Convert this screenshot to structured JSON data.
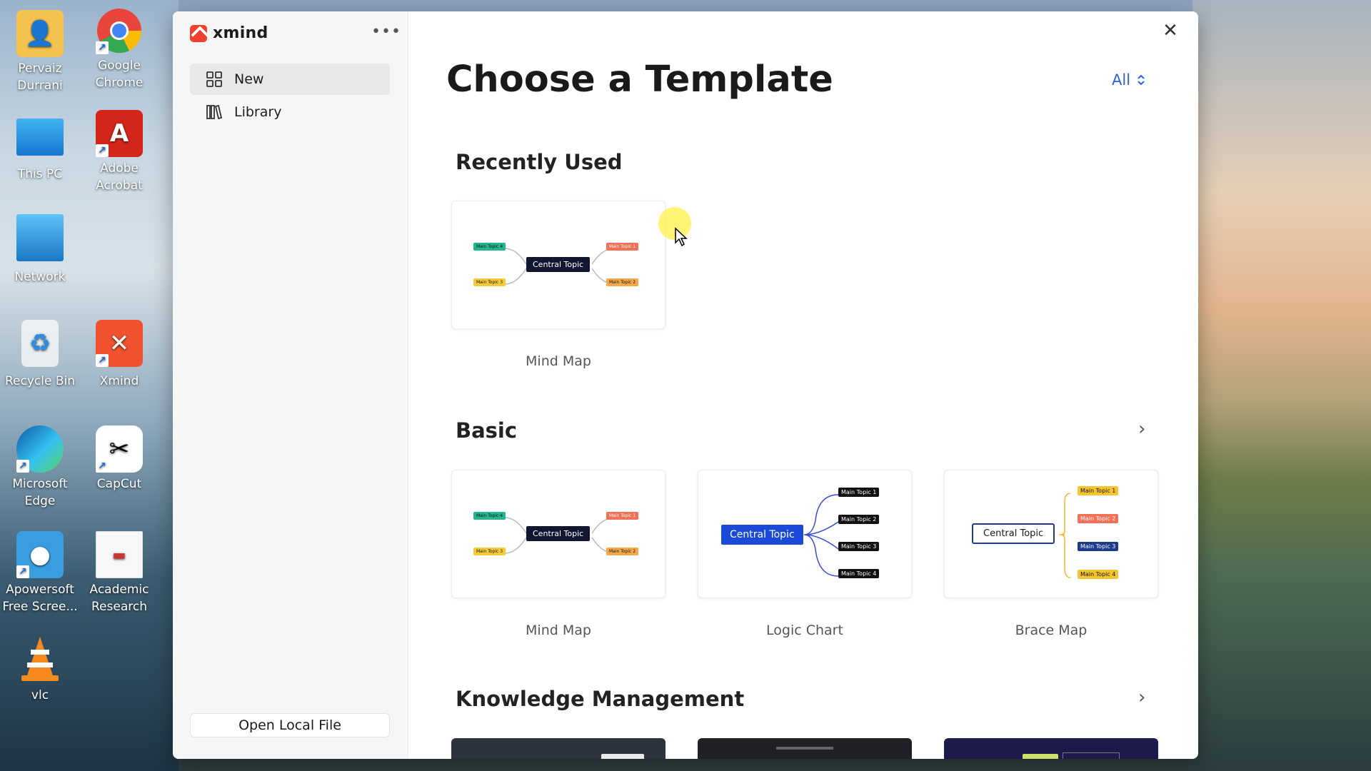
{
  "desktop": {
    "icons": [
      {
        "label_1": "Pervaiz",
        "label_2": "Durrani",
        "icon": "user-folder-icon"
      },
      {
        "label_1": "Google",
        "label_2": "Chrome",
        "icon": "chrome-icon"
      },
      {
        "label_1": "This PC",
        "label_2": "",
        "icon": "monitor-icon"
      },
      {
        "label_1": "Adobe",
        "label_2": "Acrobat",
        "icon": "acrobat-icon"
      },
      {
        "label_1": "Network",
        "label_2": "",
        "icon": "network-icon"
      },
      {
        "label_1": "Recycle Bin",
        "label_2": "",
        "icon": "recycle-bin-icon"
      },
      {
        "label_1": "Xmind",
        "label_2": "",
        "icon": "xmind-icon"
      },
      {
        "label_1": "Microsoft",
        "label_2": "Edge",
        "icon": "edge-icon"
      },
      {
        "label_1": "CapCut",
        "label_2": "",
        "icon": "capcut-icon"
      },
      {
        "label_1": "Apowersoft",
        "label_2": "Free Scree...",
        "icon": "apowersoft-icon"
      },
      {
        "label_1": "Academic",
        "label_2": "Research",
        "icon": "document-icon"
      },
      {
        "label_1": "vlc",
        "label_2": "",
        "icon": "vlc-icon"
      }
    ]
  },
  "app": {
    "name": "xmind",
    "more_label": "•••",
    "close_label": "✕"
  },
  "sidebar": {
    "items": [
      {
        "label": "New",
        "icon": "grid-icon",
        "active": true
      },
      {
        "label": "Library",
        "icon": "library-icon",
        "active": false
      }
    ],
    "open_local": "Open Local File"
  },
  "main": {
    "title": "Choose a Template",
    "filter": "All",
    "sections": [
      {
        "title": "Recently Used"
      },
      {
        "title": "Basic"
      },
      {
        "title": "Knowledge Management"
      }
    ],
    "recent_cards": [
      {
        "label": "Mind Map"
      }
    ],
    "basic_cards": [
      {
        "label": "Mind Map"
      },
      {
        "label": "Logic Chart"
      },
      {
        "label": "Brace Map"
      }
    ],
    "thumb": {
      "central": "Central Topic",
      "mt1": "Main Topic 1",
      "mt2": "Main Topic 2",
      "mt3": "Main Topic 3",
      "mt4": "Main Topic 4"
    }
  },
  "colors": {
    "accent": "#2d63d8",
    "brand": "#f0402f"
  }
}
